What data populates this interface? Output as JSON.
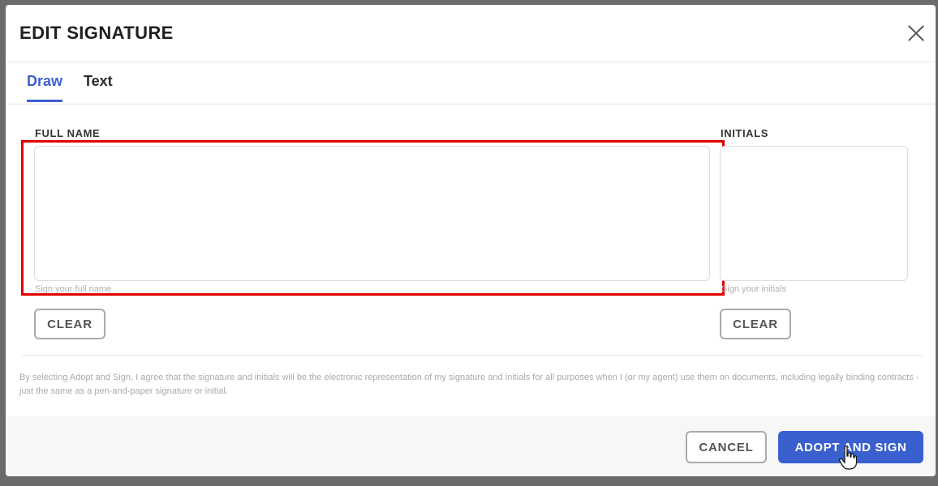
{
  "modal": {
    "title": "EDIT SIGNATURE",
    "close_icon": "close-icon"
  },
  "tabs": [
    {
      "label": "Draw",
      "active": true
    },
    {
      "label": "Text",
      "active": false
    }
  ],
  "full_name": {
    "label": "FULL NAME",
    "hint": "Sign your full name",
    "clear_label": "CLEAR"
  },
  "initials": {
    "label": "INITIALS",
    "hint": "Sign your initials",
    "clear_label": "CLEAR"
  },
  "disclaimer": "By selecting Adopt and Sign, I agree that the signature and initials will be the electronic representation of my signature and initials for all purposes when I (or my agent) use them on documents, including legally binding contracts - just the same as a pen-and-paper signature or initial.",
  "footer": {
    "cancel_label": "CANCEL",
    "adopt_label": "ADOPT AND SIGN"
  },
  "highlight": {
    "color": "#e00000"
  },
  "accent_color": "#3a60d0"
}
